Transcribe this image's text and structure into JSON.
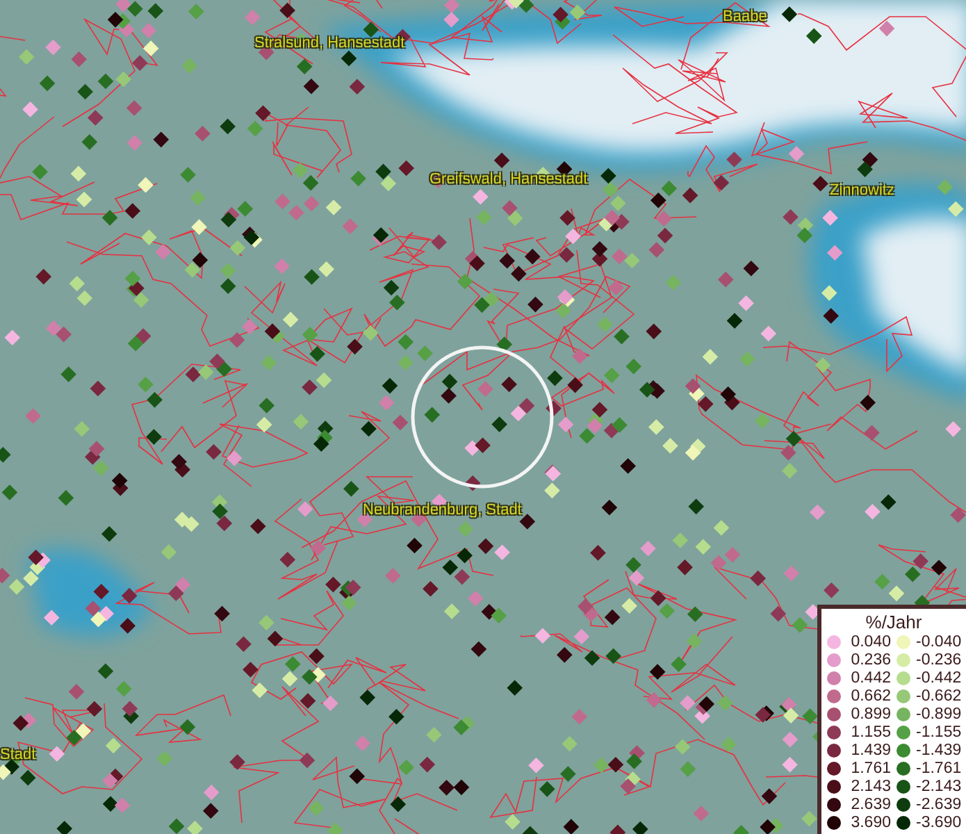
{
  "map": {
    "places": [
      {
        "name": "Stralsund, Hansestadt"
      },
      {
        "name": "Baabe"
      },
      {
        "name": "Greifswald, Hansestadt"
      },
      {
        "name": "Zinnowitz"
      },
      {
        "name": "Neubrandenburg, Stadt"
      },
      {
        "name": "Stadt"
      }
    ]
  },
  "legend": {
    "title": "%/Jahr",
    "columns": [
      [
        {
          "label": "0.040",
          "color": "#f4b6e0"
        },
        {
          "label": "0.236",
          "color": "#e49ccb"
        },
        {
          "label": "0.442",
          "color": "#d080aa"
        },
        {
          "label": "0.662",
          "color": "#c06a8e"
        },
        {
          "label": "0.899",
          "color": "#a85070"
        },
        {
          "label": "1.155",
          "color": "#8e3a56"
        },
        {
          "label": "1.439",
          "color": "#7a2840"
        },
        {
          "label": "1.761",
          "color": "#641828"
        },
        {
          "label": "2.143",
          "color": "#4a0e18"
        },
        {
          "label": "2.639",
          "color": "#330810"
        },
        {
          "label": "3.690",
          "color": "#200406"
        }
      ],
      [
        {
          "label": "-0.040",
          "color": "#f0f5b8"
        },
        {
          "label": "-0.236",
          "color": "#d6eca6"
        },
        {
          "label": "-0.442",
          "color": "#b6dc8e"
        },
        {
          "label": "-0.662",
          "color": "#96c878"
        },
        {
          "label": "-0.899",
          "color": "#76b460"
        },
        {
          "label": "-1.155",
          "color": "#56a046"
        },
        {
          "label": "-1.439",
          "color": "#3c8a32"
        },
        {
          "label": "-1.761",
          "color": "#286e22"
        },
        {
          "label": "-2.143",
          "color": "#185416"
        },
        {
          "label": "-2.639",
          "color": "#0e3c0e"
        },
        {
          "label": "-3.690",
          "color": "#062806"
        }
      ]
    ]
  }
}
